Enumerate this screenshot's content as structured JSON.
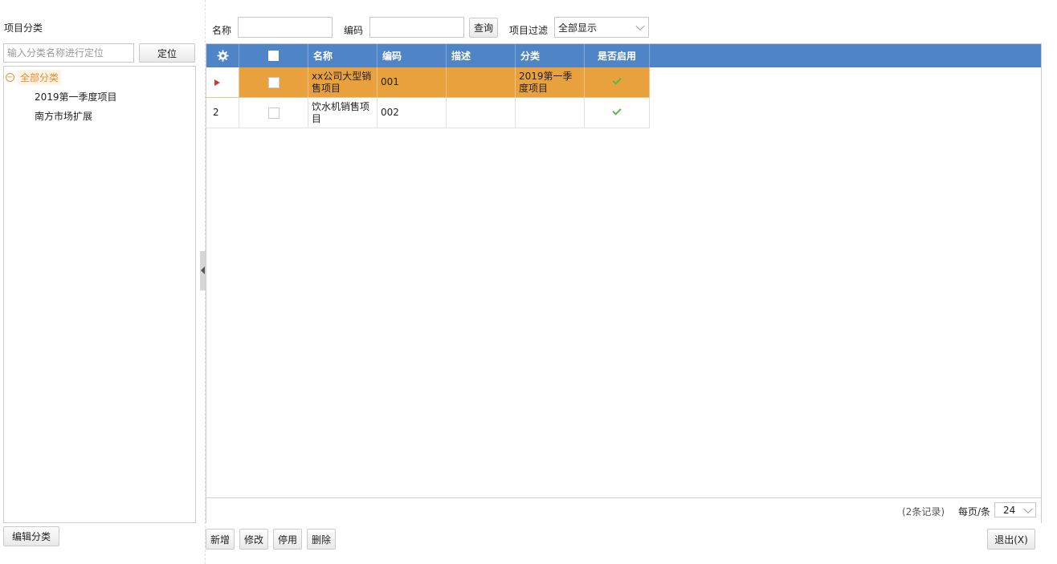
{
  "left": {
    "title": "项目分类",
    "search_placeholder": "输入分类名称进行定位",
    "locate_label": "定位",
    "tree": {
      "root": "全部分类",
      "children": [
        "2019第一季度项目",
        "南方市场扩展"
      ]
    },
    "edit_category_label": "编辑分类"
  },
  "filter": {
    "name_label": "名称",
    "name_value": "",
    "code_label": "编码",
    "code_value": "",
    "query_label": "查询",
    "project_filter_label": "项目过滤",
    "project_filter_value": "全部显示"
  },
  "grid": {
    "columns": [
      "名称",
      "编码",
      "描述",
      "分类",
      "是否启用"
    ],
    "rows": [
      {
        "indicator": "selected",
        "name": "xx公司大型销售项目",
        "code": "001",
        "desc": "",
        "category": "2019第一季度项目",
        "enabled": true
      },
      {
        "rownum": "2",
        "name": "饮水机销售项目",
        "code": "002",
        "desc": "",
        "category": "",
        "enabled": true
      }
    ]
  },
  "footer": {
    "records": "(2条记录)",
    "per_page_label": "每页/条",
    "per_page_value": "24"
  },
  "actions": {
    "add": "新增",
    "edit": "修改",
    "disable": "停用",
    "delete": "删除",
    "exit": "退出(X)"
  },
  "colors": {
    "header_bg": "#4f85c6",
    "selected_row": "#e8a13c",
    "tree_active": "#e58e2c",
    "check": "#55b94c"
  }
}
